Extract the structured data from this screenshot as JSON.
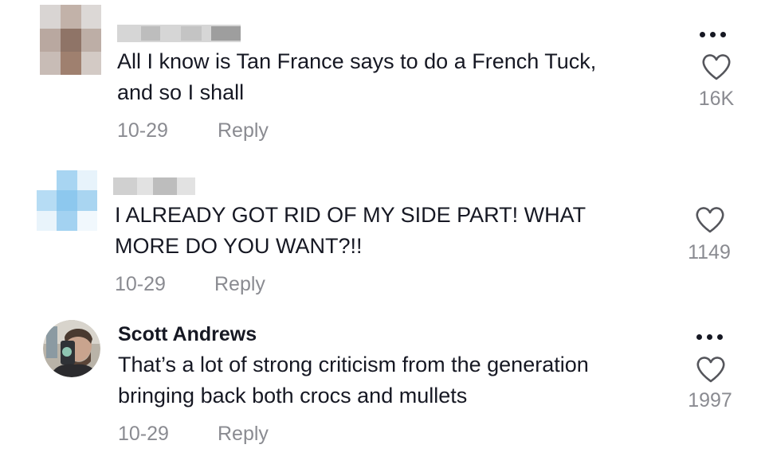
{
  "comments": [
    {
      "username": "",
      "text_lines": [
        "All I know is Tan France says to do a French Tuck,",
        "and so I shall"
      ],
      "date": "10-29",
      "reply_label": "Reply",
      "like_count": "16K",
      "has_more_menu": true,
      "avatar_blurred": true,
      "username_blurred": true
    },
    {
      "username": "",
      "text_lines": [
        "I ALREADY GOT RID OF MY SIDE PART! WHAT",
        "MORE DO YOU WANT?!!"
      ],
      "date": "10-29",
      "reply_label": "Reply",
      "like_count": "1149",
      "has_more_menu": false,
      "avatar_blurred": true,
      "username_blurred": true
    },
    {
      "username": "Scott Andrews",
      "text_lines": [
        "That’s a lot of strong criticism from the generation",
        "bringing back both crocs and mullets"
      ],
      "date": "10-29",
      "reply_label": "Reply",
      "like_count": "1997",
      "has_more_menu": true,
      "avatar_blurred": false,
      "username_blurred": false
    }
  ],
  "colors": {
    "text": "#161823",
    "secondary": "#8a8b91",
    "background": "#ffffff"
  },
  "icons": [
    "more-icon",
    "heart-icon"
  ]
}
